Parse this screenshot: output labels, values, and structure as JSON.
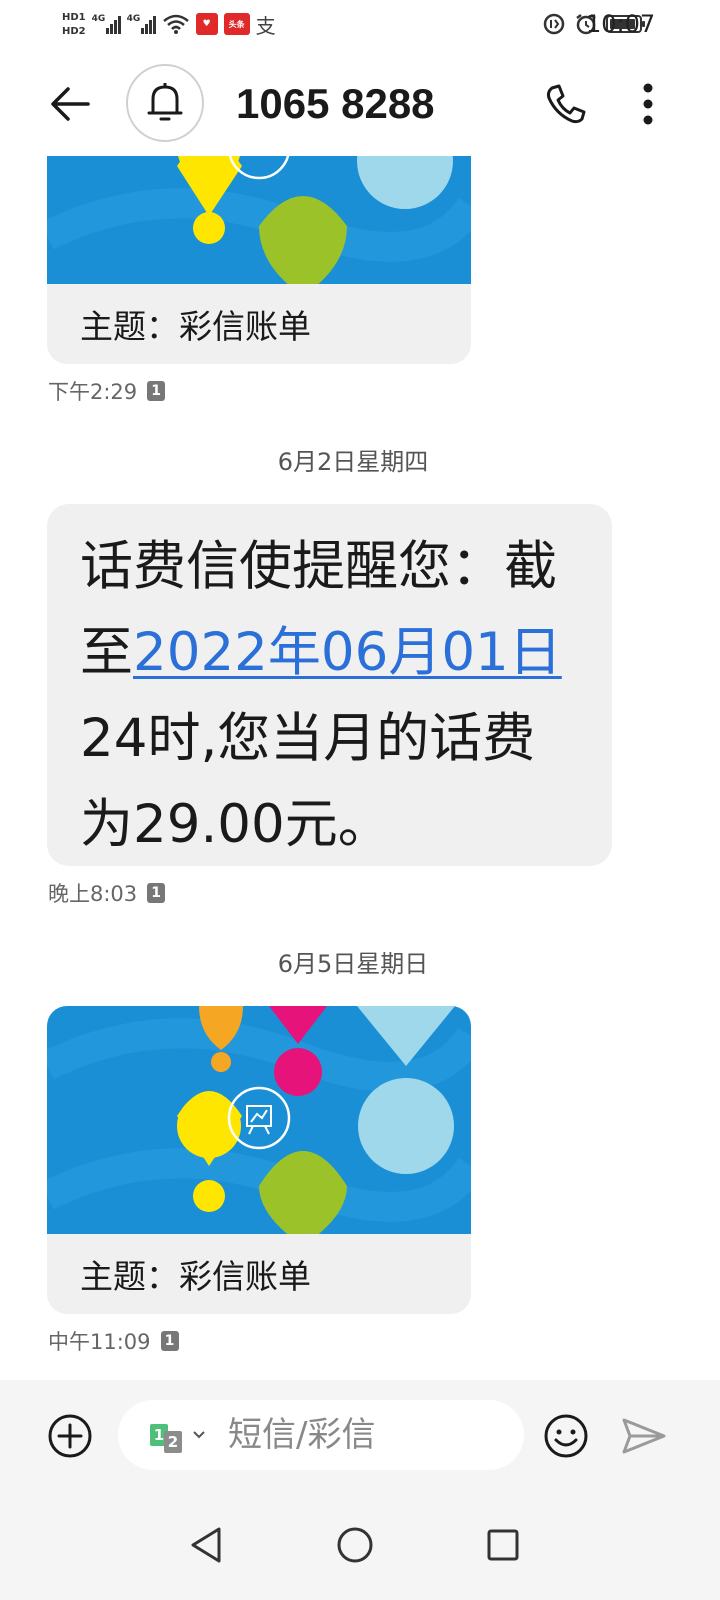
{
  "status_bar": {
    "hd1": "HD1",
    "hd2": "HD2",
    "net1": "4G",
    "net2": "4G",
    "app_badge_1": "",
    "app_badge_2": "头条",
    "pay_glyph": "支",
    "time": "10:07",
    "battery_level": 0.9
  },
  "header": {
    "contact_name": "1065 8288",
    "icons": [
      "back-arrow-icon",
      "bell-icon",
      "phone-icon",
      "more-vertical-icon"
    ]
  },
  "conversation": {
    "mms_top": {
      "subject": "主题：彩信账单",
      "timestamp": "下午2:29",
      "sim": "1"
    },
    "date_separator_1": "6月2日星期四",
    "sms": {
      "before_link": "话费信使提醒您：截至",
      "link": "2022年06月01日",
      "after_link": "24时,您当月的话费为29.00元。",
      "timestamp": "晚上8:03",
      "sim": "1"
    },
    "date_separator_2": "6月5日星期日",
    "mms_bottom": {
      "subject": "主题：彩信账单",
      "timestamp": "中午11:09",
      "sim": "1"
    }
  },
  "composer": {
    "sim_1": "1",
    "sim_2": "2",
    "placeholder": "短信/彩信"
  },
  "colors": {
    "link": "#2b6fd8",
    "bubble": "#f0f0f0",
    "mms_bg_blue": "#1a8fd6",
    "balloon_yellow": "#ffe600",
    "balloon_green": "#9cc22a",
    "balloon_lightblue": "#9fd8ea",
    "balloon_magenta": "#e6147a",
    "balloon_orange": "#f5a623"
  }
}
